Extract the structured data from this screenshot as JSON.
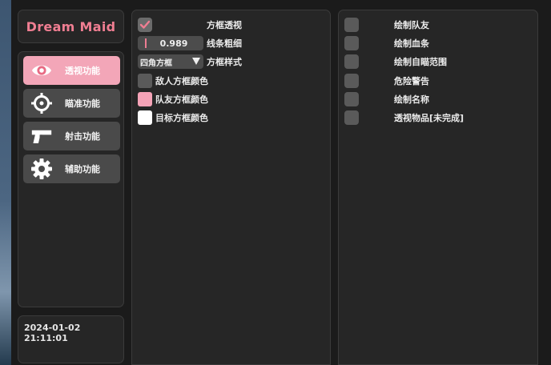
{
  "app": {
    "title": "Dream Maid",
    "datetime": "2024-01-02 21:11:01"
  },
  "nav": [
    {
      "label": "透视功能",
      "icon": "eye-icon",
      "active": true
    },
    {
      "label": "瞄准功能",
      "icon": "crosshair-icon",
      "active": false
    },
    {
      "label": "射击功能",
      "icon": "pistol-icon",
      "active": false
    },
    {
      "label": "辅助功能",
      "icon": "gear-icon",
      "active": false
    }
  ],
  "main": {
    "box_esp": {
      "label": "方框透视",
      "checked": true
    },
    "line_width": {
      "label": "线条粗细",
      "value": "0.989"
    },
    "box_style": {
      "label": "方框样式",
      "value": "四角方框"
    },
    "enemy_color": {
      "label": "敌人方框颜色",
      "color": "#5a5a5a"
    },
    "team_color": {
      "label": "队友方框颜色",
      "color": "#f5a3b7"
    },
    "target_color": {
      "label": "目标方框颜色",
      "color": "#ffffff"
    }
  },
  "right": {
    "items": [
      {
        "label": "绘制队友",
        "checked": false
      },
      {
        "label": "绘制血条",
        "checked": false
      },
      {
        "label": "绘制自瞄范围",
        "checked": false
      },
      {
        "label": "危险警告",
        "checked": false
      },
      {
        "label": "绘制名称",
        "checked": false
      },
      {
        "label": "透视物品[未完成]",
        "checked": false
      }
    ]
  },
  "colors": {
    "accent": "#f07e92",
    "active_button": "#f3a6b8",
    "panel": "#262626",
    "control": "#4c4c4c"
  }
}
